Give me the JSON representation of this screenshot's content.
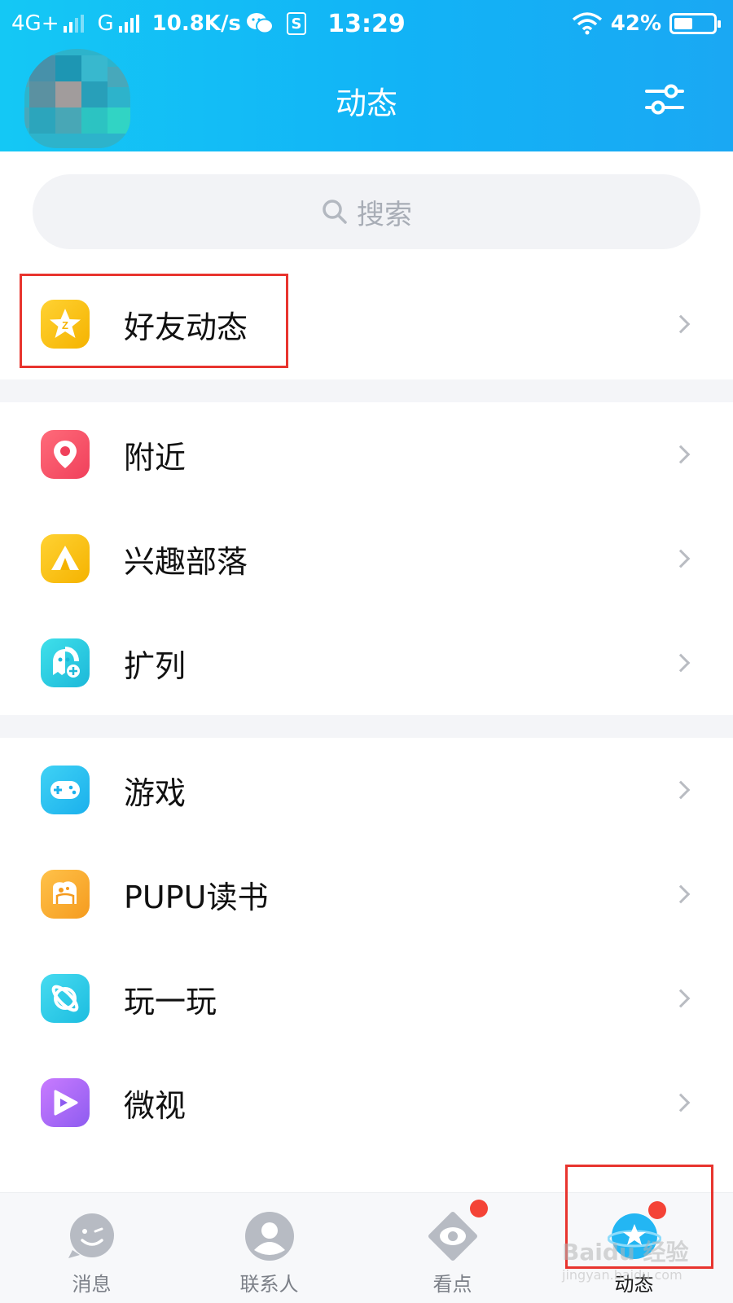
{
  "status_bar": {
    "network_1": "4G+",
    "network_2": "G",
    "speed": "10.8K/s",
    "time": "13:29",
    "battery": "42%"
  },
  "header": {
    "title": "动态"
  },
  "search": {
    "placeholder": "搜索"
  },
  "list": {
    "friends_feed": "好友动态",
    "nearby": "附近",
    "interest_tribe": "兴趣部落",
    "expand": "扩列",
    "games": "游戏",
    "pupu_reading": "PUPU读书",
    "play": "玩一玩",
    "weishi": "微视"
  },
  "bottom_nav": {
    "messages": "消息",
    "contacts": "联系人",
    "watch": "看点",
    "feed": "动态"
  },
  "watermark": {
    "brand": "Baidu 经验",
    "url": "jingyan.baidu.com"
  },
  "colors": {
    "header_accent": "#14c8f5",
    "highlight_box": "#e8342e",
    "badge": "#f44336"
  }
}
